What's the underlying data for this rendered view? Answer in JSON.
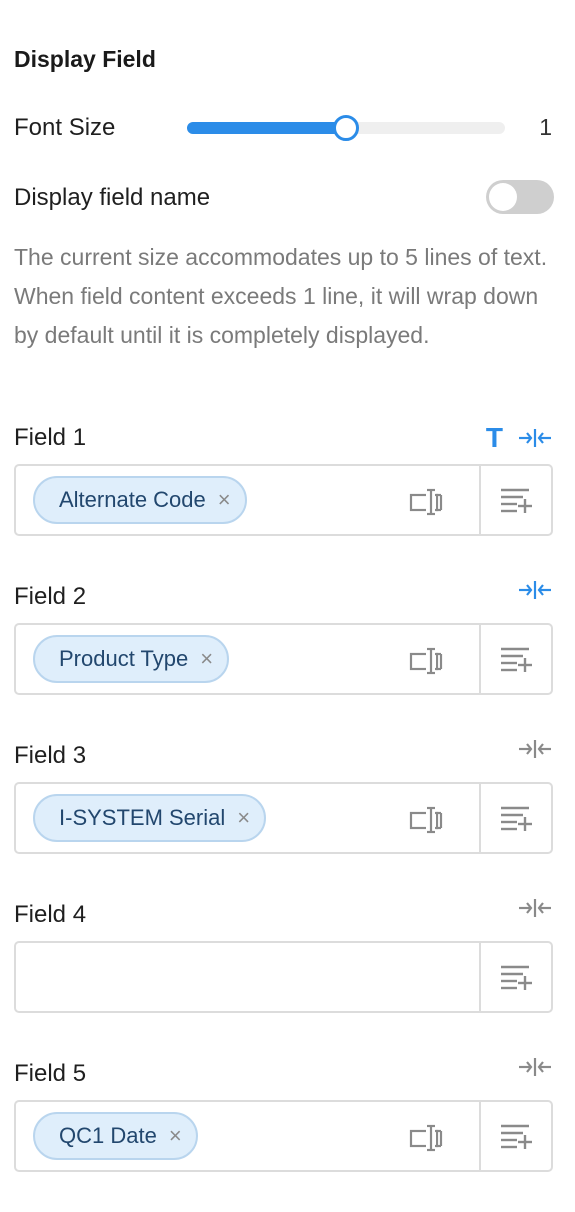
{
  "section": {
    "title": "Display Field"
  },
  "font_size": {
    "label": "Font Size",
    "value": "1",
    "slider_fraction": 0.5
  },
  "display_field_name": {
    "label": "Display field name",
    "enabled": false
  },
  "description": "The current size accommodates up to 5 lines of text. When field content exceeds 1 line, it will wrap down by default until it is completely displayed.",
  "fields": [
    {
      "label": "Field 1",
      "chip": "Alternate Code",
      "text_icon": "T",
      "show_text_icon": true,
      "compress_active": true
    },
    {
      "label": "Field 2",
      "chip": "Product Type",
      "show_text_icon": false,
      "compress_active": true
    },
    {
      "label": "Field 3",
      "chip": "I-SYSTEM Serial",
      "show_text_icon": false,
      "compress_active": false
    },
    {
      "label": "Field 4",
      "chip": "",
      "show_text_icon": false,
      "compress_active": false
    },
    {
      "label": "Field 5",
      "chip": "QC1 Date",
      "show_text_icon": false,
      "compress_active": false
    }
  ],
  "colors": {
    "accent": "#2b8ce8",
    "icon_gray": "#8a8a8a",
    "chip_bg": "#dfeefb",
    "chip_border": "#b9d5ee"
  },
  "icons": {
    "chip_close": "×",
    "compress": "compress-width-icon",
    "width": "column-width-icon",
    "add": "add-list-icon"
  }
}
